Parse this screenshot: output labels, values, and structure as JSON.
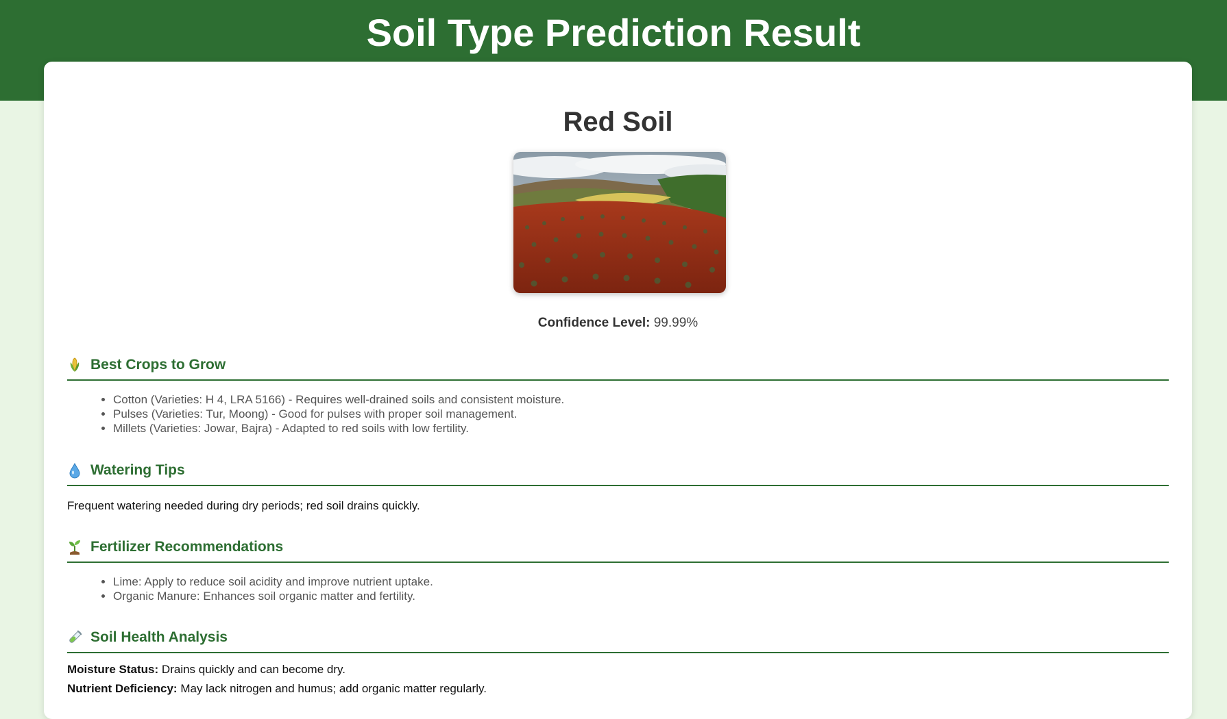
{
  "header": {
    "title": "Soil Type Prediction Result"
  },
  "result": {
    "soil_name": "Red Soil",
    "image_alt": "Red soil field landscape",
    "confidence_label": "Confidence Level:",
    "confidence_value": "99.99%"
  },
  "sections": {
    "crops": {
      "icon": "corn-icon",
      "title": "Best Crops to Grow",
      "items": [
        "Cotton (Varieties: H 4, LRA 5166) - Requires well-drained soils and consistent moisture.",
        "Pulses (Varieties: Tur, Moong) - Good for pulses with proper soil management.",
        "Millets (Varieties: Jowar, Bajra) - Adapted to red soils with low fertility."
      ]
    },
    "watering": {
      "icon": "water-drop-icon",
      "title": "Watering Tips",
      "text": "Frequent watering needed during dry periods; red soil drains quickly."
    },
    "fertilizer": {
      "icon": "seedling-icon",
      "title": "Fertilizer Recommendations",
      "items": [
        "Lime: Apply to reduce soil acidity and improve nutrient uptake.",
        "Organic Manure: Enhances soil organic matter and fertility."
      ]
    },
    "health": {
      "icon": "test-tube-icon",
      "title": "Soil Health Analysis",
      "rows": [
        {
          "label": "Moisture Status:",
          "value": "Drains quickly and can become dry."
        },
        {
          "label": "Nutrient Deficiency:",
          "value": "May lack nitrogen and humus; add organic matter regularly."
        }
      ]
    }
  },
  "colors": {
    "brand_green": "#2d6e32",
    "page_bg": "#e9f5e4",
    "card_bg": "#ffffff"
  }
}
